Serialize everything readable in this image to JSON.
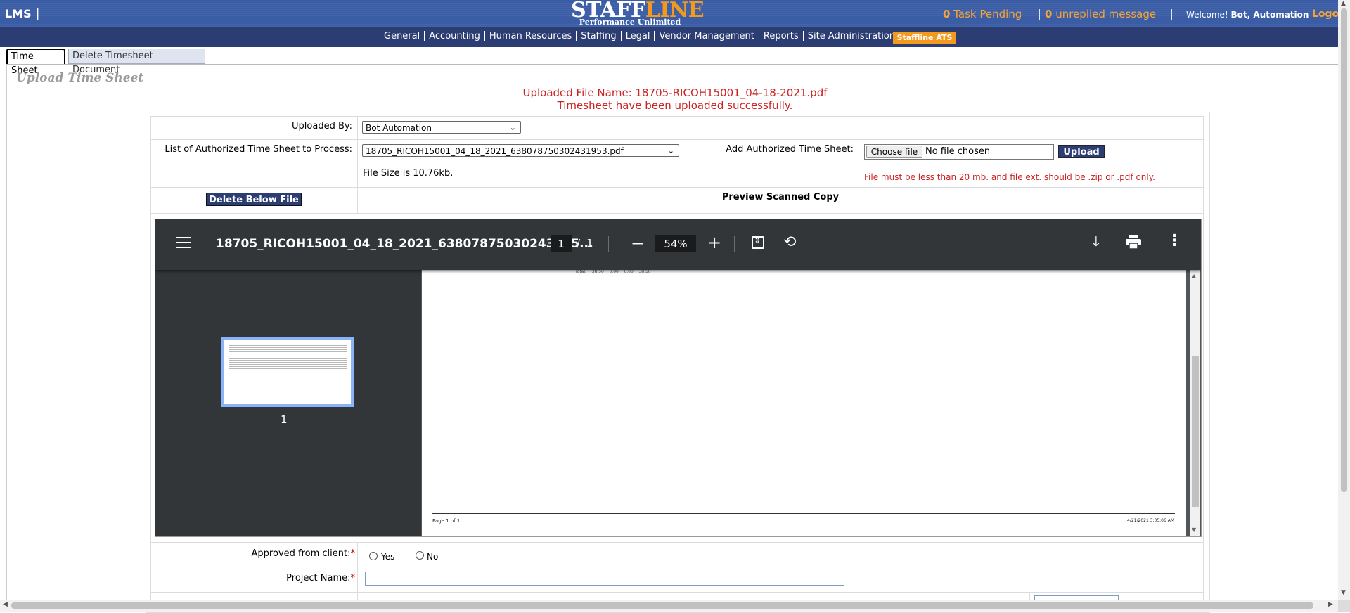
{
  "header": {
    "app_name": "LMS",
    "separator": "|",
    "logo_text_a": "STAFF",
    "logo_text_b": "LINE",
    "logo_subtitle": "Performance Unlimited",
    "task_count": "0",
    "task_label": "Task Pending",
    "message_count": "0",
    "message_label": "unreplied message",
    "welcome_prefix": "Welcome!",
    "user_name": "Bot, Automation",
    "logout_label": "Logo"
  },
  "nav": {
    "items": [
      "General",
      "Accounting",
      "Human Resources",
      "Staffing",
      "Legal",
      "Vendor Management",
      "Reports",
      "Site Administration"
    ],
    "ats_label": "Staffline ATS"
  },
  "tabs": {
    "active": "Time Sheet",
    "inactive": "Delete Timesheet Document"
  },
  "page": {
    "title": "Upload Time Sheet",
    "uploaded_msg": "Uploaded File Name: 18705-RICOH15001_04-18-2021.pdf",
    "success_msg": "Timesheet have been uploaded successfully."
  },
  "form": {
    "uploaded_by_label": "Uploaded By:",
    "uploaded_by_value": "Bot Automation",
    "list_label": "List of Authorized Time Sheet to Process:",
    "list_value": "18705_RICOH15001_04_18_2021_638078750302431953.pdf",
    "file_size": "File Size is 10.76kb.",
    "add_label": "Add Authorized Time Sheet:",
    "choose_file": "Choose file",
    "no_file": "No file chosen",
    "upload_label": "Upload",
    "hint": "File must be less than 20 mb. and file ext. should be .zip or .pdf only.",
    "delete_label": "Delete Below File",
    "preview_label": "Preview Scanned Copy",
    "approved_label": "Approved from client:",
    "yes_label": "Yes",
    "no_label": "No",
    "project_label": "Project Name:",
    "required_mark": "*"
  },
  "viewer": {
    "title": "18705_RICOH15001_04_18_2021_63807875030243195...",
    "page_current": "1",
    "page_sep": "/",
    "page_total": "1",
    "zoom": "54%",
    "thumb_page": "1",
    "pdf_total_row": "Total:    38.50    0.00    0.00    38.50",
    "pdf_footer_left": "Page 1 of 1",
    "pdf_footer_right": "4/21/2021 3:05:06 AM",
    "icons": [
      "menu-icon",
      "minus-icon",
      "plus-icon",
      "fit-page-icon",
      "rotate-icon",
      "download-icon",
      "print-icon",
      "more-icon"
    ]
  },
  "colors": {
    "topbar": "#3a5da6",
    "navbar": "#2b3d73",
    "accent_orange": "#f39a1e",
    "error_red": "#cc2222",
    "viewer_dark": "#323639"
  }
}
